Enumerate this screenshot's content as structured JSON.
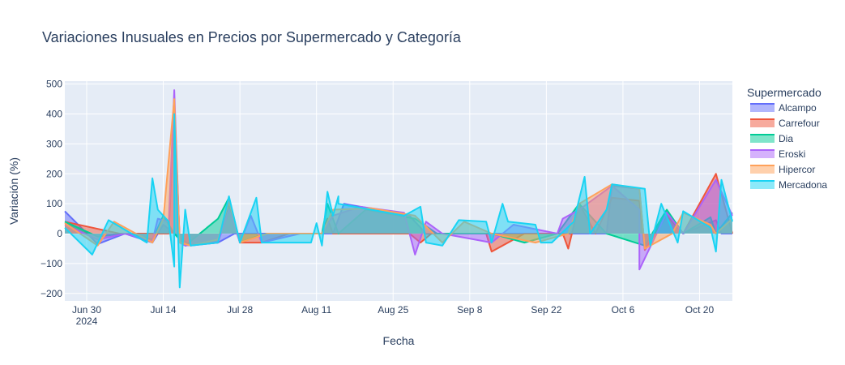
{
  "chart_data": {
    "type": "area",
    "title": "Variaciones Inusuales en Precios por Supermercado y Categoría",
    "xlabel": "Fecha",
    "ylabel": "Variación (%)",
    "x_range": [
      "2024-06-26",
      "2024-10-26"
    ],
    "ylim": [
      -225,
      510
    ],
    "x_ticks": [
      {
        "date": "2024-06-30",
        "label": "Jun 30",
        "sub": "2024"
      },
      {
        "date": "2024-07-14",
        "label": "Jul 14"
      },
      {
        "date": "2024-07-28",
        "label": "Jul 28"
      },
      {
        "date": "2024-08-11",
        "label": "Aug 11"
      },
      {
        "date": "2024-08-25",
        "label": "Aug 25"
      },
      {
        "date": "2024-09-08",
        "label": "Sep 8"
      },
      {
        "date": "2024-09-22",
        "label": "Sep 22"
      },
      {
        "date": "2024-10-06",
        "label": "Oct 6"
      },
      {
        "date": "2024-10-20",
        "label": "Oct 20"
      }
    ],
    "y_ticks": [
      500,
      400,
      300,
      200,
      100,
      0,
      -100,
      -200
    ],
    "y_tick_labels": [
      "500",
      "400",
      "300",
      "200",
      "100",
      "0",
      "−100",
      "−200"
    ],
    "grid": true,
    "legend_position": "right",
    "legend_title": "Supermercado",
    "series": [
      {
        "name": "Alcampo",
        "color": "#636efa",
        "points": [
          [
            "2024-06-26",
            75
          ],
          [
            "2024-07-02",
            -35
          ],
          [
            "2024-07-07",
            0
          ],
          [
            "2024-07-12",
            -30
          ],
          [
            "2024-07-14",
            30
          ],
          [
            "2024-07-16",
            0
          ],
          [
            "2024-07-19",
            -40
          ],
          [
            "2024-07-24",
            -30
          ],
          [
            "2024-07-27",
            0
          ],
          [
            "2024-08-14",
            0
          ],
          [
            "2024-08-16",
            100
          ],
          [
            "2024-08-22",
            80
          ],
          [
            "2024-08-28",
            60
          ],
          [
            "2024-08-31",
            0
          ],
          [
            "2024-09-03",
            0
          ],
          [
            "2024-09-12",
            0
          ],
          [
            "2024-09-21",
            0
          ],
          [
            "2024-09-24",
            0
          ],
          [
            "2024-09-27",
            0
          ],
          [
            "2024-10-03",
            0
          ],
          [
            "2024-10-04",
            160
          ],
          [
            "2024-10-09",
            150
          ],
          [
            "2024-10-10",
            -50
          ],
          [
            "2024-10-14",
            70
          ],
          [
            "2024-10-17",
            0
          ],
          [
            "2024-10-23",
            45
          ],
          [
            "2024-10-24",
            0
          ],
          [
            "2024-10-26",
            0
          ]
        ]
      },
      {
        "name": "Carrefour",
        "color": "#ef553b",
        "points": [
          [
            "2024-06-26",
            40
          ],
          [
            "2024-07-06",
            0
          ],
          [
            "2024-07-15",
            0
          ],
          [
            "2024-07-16",
            420
          ],
          [
            "2024-07-17",
            -20
          ],
          [
            "2024-07-18",
            -40
          ],
          [
            "2024-07-24",
            -30
          ],
          [
            "2024-07-26",
            100
          ],
          [
            "2024-07-28",
            -30
          ],
          [
            "2024-08-01",
            -30
          ],
          [
            "2024-08-06",
            0
          ],
          [
            "2024-08-12",
            0
          ],
          [
            "2024-08-13",
            50
          ],
          [
            "2024-08-14",
            0
          ],
          [
            "2024-08-28",
            0
          ],
          [
            "2024-08-30",
            -30
          ],
          [
            "2024-09-01",
            0
          ],
          [
            "2024-09-11",
            0
          ],
          [
            "2024-09-12",
            -60
          ],
          [
            "2024-09-18",
            0
          ],
          [
            "2024-09-25",
            0
          ],
          [
            "2024-09-26",
            -50
          ],
          [
            "2024-09-28",
            100
          ],
          [
            "2024-10-01",
            0
          ],
          [
            "2024-10-04",
            120
          ],
          [
            "2024-10-09",
            110
          ],
          [
            "2024-10-10",
            -55
          ],
          [
            "2024-10-14",
            60
          ],
          [
            "2024-10-17",
            0
          ],
          [
            "2024-10-23",
            200
          ],
          [
            "2024-10-26",
            0
          ]
        ]
      },
      {
        "name": "Dia",
        "color": "#00cc96",
        "points": [
          [
            "2024-06-26",
            40
          ],
          [
            "2024-07-02",
            -10
          ],
          [
            "2024-07-07",
            0
          ],
          [
            "2024-07-12",
            -20
          ],
          [
            "2024-07-14",
            60
          ],
          [
            "2024-07-16",
            0
          ],
          [
            "2024-07-18",
            -40
          ],
          [
            "2024-07-24",
            50
          ],
          [
            "2024-07-26",
            120
          ],
          [
            "2024-07-28",
            -30
          ],
          [
            "2024-07-31",
            -10
          ],
          [
            "2024-08-02",
            0
          ],
          [
            "2024-08-12",
            0
          ],
          [
            "2024-08-13",
            100
          ],
          [
            "2024-08-15",
            0
          ],
          [
            "2024-08-20",
            80
          ],
          [
            "2024-08-29",
            50
          ],
          [
            "2024-09-02",
            0
          ],
          [
            "2024-09-12",
            0
          ],
          [
            "2024-09-18",
            -30
          ],
          [
            "2024-09-24",
            0
          ],
          [
            "2024-09-28",
            100
          ],
          [
            "2024-10-03",
            0
          ],
          [
            "2024-10-10",
            -40
          ],
          [
            "2024-10-14",
            80
          ],
          [
            "2024-10-17",
            0
          ],
          [
            "2024-10-22",
            55
          ],
          [
            "2024-10-23",
            0
          ],
          [
            "2024-10-26",
            70
          ]
        ]
      },
      {
        "name": "Eroski",
        "color": "#ab63fa",
        "points": [
          [
            "2024-06-26",
            30
          ],
          [
            "2024-07-02",
            -20
          ],
          [
            "2024-07-07",
            0
          ],
          [
            "2024-07-12",
            -25
          ],
          [
            "2024-07-13",
            50
          ],
          [
            "2024-07-15",
            40
          ],
          [
            "2024-07-16",
            480
          ],
          [
            "2024-07-17",
            -30
          ],
          [
            "2024-07-18",
            -40
          ],
          [
            "2024-07-24",
            -30
          ],
          [
            "2024-07-26",
            80
          ],
          [
            "2024-07-28",
            -30
          ],
          [
            "2024-07-30",
            60
          ],
          [
            "2024-08-01",
            -30
          ],
          [
            "2024-08-08",
            0
          ],
          [
            "2024-08-12",
            0
          ],
          [
            "2024-08-14",
            60
          ],
          [
            "2024-08-19",
            90
          ],
          [
            "2024-08-27",
            70
          ],
          [
            "2024-08-29",
            -70
          ],
          [
            "2024-08-31",
            40
          ],
          [
            "2024-09-03",
            0
          ],
          [
            "2024-09-12",
            -30
          ],
          [
            "2024-09-16",
            30
          ],
          [
            "2024-09-24",
            0
          ],
          [
            "2024-09-25",
            50
          ],
          [
            "2024-09-28",
            80
          ],
          [
            "2024-10-04",
            160
          ],
          [
            "2024-10-09",
            80
          ],
          [
            "2024-10-09",
            -120
          ],
          [
            "2024-10-14",
            70
          ],
          [
            "2024-10-17",
            0
          ],
          [
            "2024-10-23",
            180
          ],
          [
            "2024-10-26",
            60
          ]
        ]
      },
      {
        "name": "Hipercor",
        "color": "#ffa15a",
        "points": [
          [
            "2024-06-26",
            35
          ],
          [
            "2024-07-02",
            -40
          ],
          [
            "2024-07-05",
            40
          ],
          [
            "2024-07-12",
            -30
          ],
          [
            "2024-07-14",
            50
          ],
          [
            "2024-07-16",
            450
          ],
          [
            "2024-07-17",
            -30
          ],
          [
            "2024-07-19",
            -40
          ],
          [
            "2024-07-24",
            -20
          ],
          [
            "2024-07-26",
            110
          ],
          [
            "2024-07-28",
            -30
          ],
          [
            "2024-08-02",
            0
          ],
          [
            "2024-08-12",
            0
          ],
          [
            "2024-08-14",
            80
          ],
          [
            "2024-08-21",
            85
          ],
          [
            "2024-08-29",
            60
          ],
          [
            "2024-09-03",
            -30
          ],
          [
            "2024-09-07",
            40
          ],
          [
            "2024-09-12",
            0
          ],
          [
            "2024-09-20",
            -30
          ],
          [
            "2024-09-26",
            0
          ],
          [
            "2024-09-28",
            100
          ],
          [
            "2024-10-04",
            165
          ],
          [
            "2024-10-09",
            150
          ],
          [
            "2024-10-10",
            -50
          ],
          [
            "2024-10-15",
            0
          ],
          [
            "2024-10-17",
            70
          ],
          [
            "2024-10-22",
            30
          ],
          [
            "2024-10-23",
            0
          ],
          [
            "2024-10-26",
            50
          ]
        ]
      },
      {
        "name": "Mercadona",
        "color": "#19d3f3",
        "points": [
          [
            "2024-06-26",
            20
          ],
          [
            "2024-07-01",
            -70
          ],
          [
            "2024-07-04",
            45
          ],
          [
            "2024-07-11",
            -30
          ],
          [
            "2024-07-12",
            185
          ],
          [
            "2024-07-13",
            80
          ],
          [
            "2024-07-15",
            40
          ],
          [
            "2024-07-16",
            -110
          ],
          [
            "2024-07-16",
            400
          ],
          [
            "2024-07-17",
            -180
          ],
          [
            "2024-07-18",
            80
          ],
          [
            "2024-07-19",
            -40
          ],
          [
            "2024-07-24",
            -30
          ],
          [
            "2024-07-26",
            125
          ],
          [
            "2024-07-28",
            -30
          ],
          [
            "2024-07-31",
            120
          ],
          [
            "2024-08-01",
            -30
          ],
          [
            "2024-08-10",
            -30
          ],
          [
            "2024-08-11",
            35
          ],
          [
            "2024-08-12",
            -40
          ],
          [
            "2024-08-13",
            140
          ],
          [
            "2024-08-14",
            60
          ],
          [
            "2024-08-15",
            125
          ],
          [
            "2024-08-15",
            100
          ],
          [
            "2024-08-27",
            60
          ],
          [
            "2024-08-30",
            90
          ],
          [
            "2024-08-31",
            -30
          ],
          [
            "2024-09-03",
            -40
          ],
          [
            "2024-09-06",
            45
          ],
          [
            "2024-09-11",
            40
          ],
          [
            "2024-09-12",
            -30
          ],
          [
            "2024-09-14",
            100
          ],
          [
            "2024-09-15",
            40
          ],
          [
            "2024-09-20",
            30
          ],
          [
            "2024-09-21",
            -30
          ],
          [
            "2024-09-23",
            -30
          ],
          [
            "2024-09-27",
            40
          ],
          [
            "2024-09-29",
            190
          ],
          [
            "2024-09-30",
            0
          ],
          [
            "2024-10-03",
            80
          ],
          [
            "2024-10-04",
            165
          ],
          [
            "2024-10-10",
            150
          ],
          [
            "2024-10-11",
            -40
          ],
          [
            "2024-10-13",
            100
          ],
          [
            "2024-10-16",
            -30
          ],
          [
            "2024-10-17",
            75
          ],
          [
            "2024-10-22",
            20
          ],
          [
            "2024-10-23",
            -60
          ],
          [
            "2024-10-24",
            180
          ],
          [
            "2024-10-26",
            40
          ]
        ]
      }
    ]
  }
}
